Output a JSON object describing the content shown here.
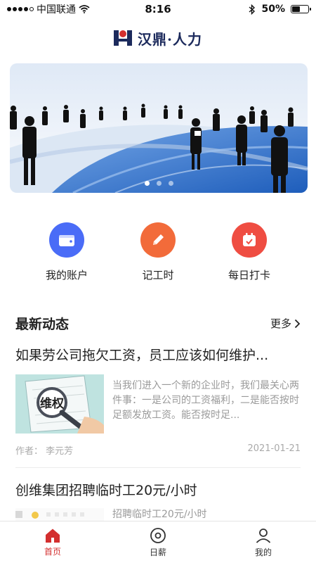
{
  "status_bar": {
    "carrier": "中国联通",
    "time": "8:16",
    "battery": "50%",
    "battery_level": 0.5
  },
  "header": {
    "brand": "汉鼎·人力"
  },
  "banner": {
    "slides": 3,
    "active_index": 0
  },
  "actions": [
    {
      "label": "我的账户",
      "icon": "wallet-icon",
      "color": "#4a6cf7"
    },
    {
      "label": "记工时",
      "icon": "pencil-icon",
      "color": "#f26b3a"
    },
    {
      "label": "每日打卡",
      "icon": "calendar-icon",
      "color": "#ef4d42"
    }
  ],
  "news": {
    "title": "最新动态",
    "more": "更多",
    "items": [
      {
        "title": "如果劳公司拖欠工资，员工应该如何维护...",
        "summary": "当我们进入一个新的企业时，我们最关心两件事：一是公司的工资福利，二是能否按时足额发放工资。能否按时足...",
        "author": "作者：  李元芳",
        "date": "2021-01-21"
      },
      {
        "title": "创维集团招聘临时工20元/小时",
        "summary": "招聘临时工20元/小时"
      }
    ]
  },
  "tabbar": {
    "tabs": [
      {
        "label": "首页",
        "icon": "home-icon"
      },
      {
        "label": "日薪",
        "icon": "coin-icon"
      },
      {
        "label": "我的",
        "icon": "user-icon"
      }
    ],
    "active": "首页",
    "accent": "#d32f2f"
  }
}
